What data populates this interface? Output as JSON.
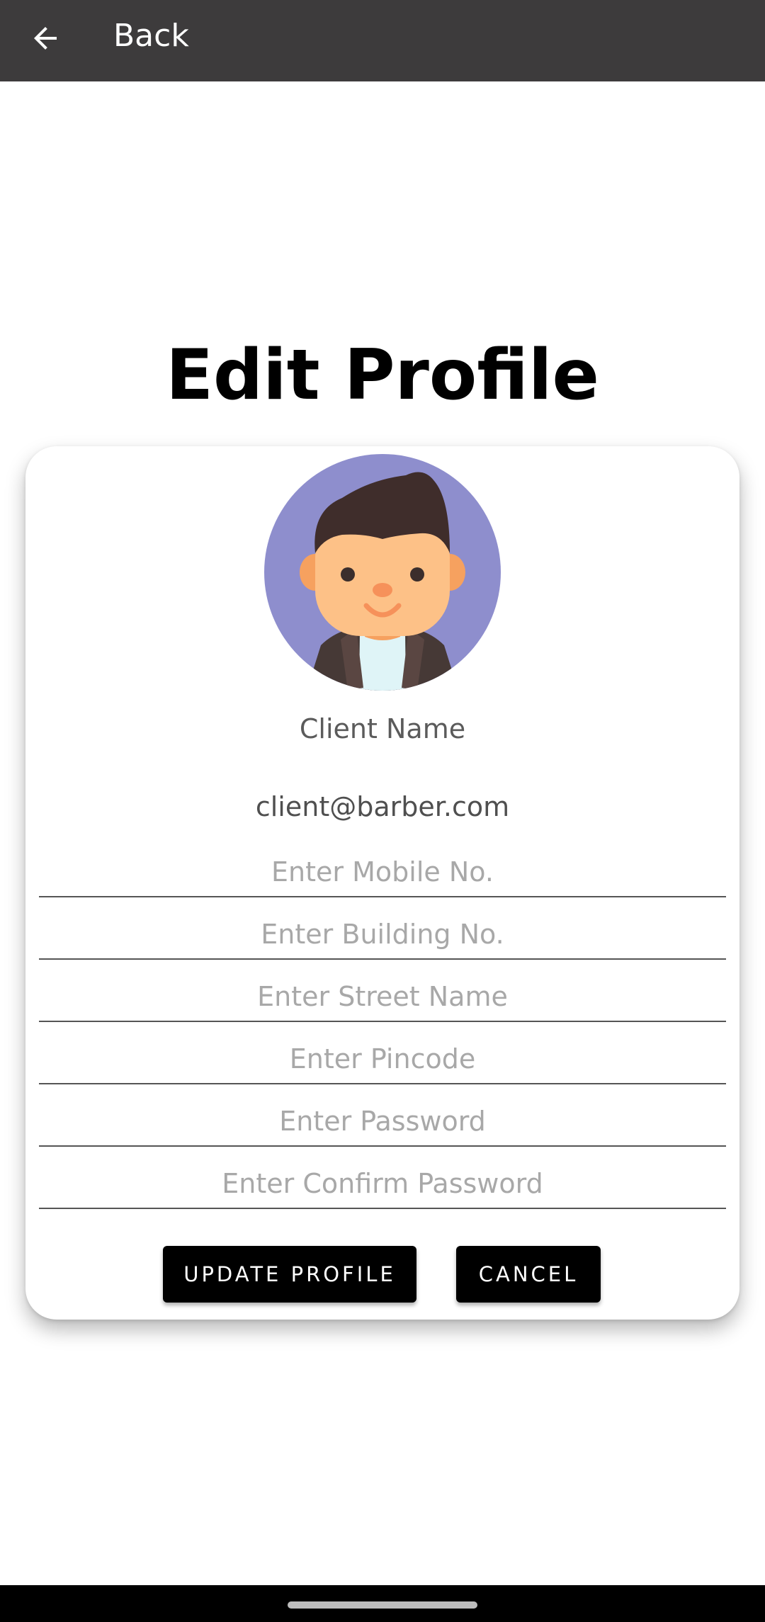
{
  "app_bar": {
    "back_label": "Back",
    "background": "#3d3b3c"
  },
  "page": {
    "title": "Edit Profile"
  },
  "profile": {
    "avatar": "boy-avatar-icon",
    "name": "Client Name",
    "email": "client@barber.com"
  },
  "form": {
    "fields": [
      {
        "name": "mobile",
        "value": "",
        "placeholder": "Enter Mobile No."
      },
      {
        "name": "building",
        "value": "",
        "placeholder": "Enter Building No."
      },
      {
        "name": "street",
        "value": "",
        "placeholder": "Enter Street Name"
      },
      {
        "name": "pincode",
        "value": "",
        "placeholder": "Enter Pincode"
      },
      {
        "name": "password",
        "value": "",
        "placeholder": "Enter Password"
      },
      {
        "name": "confirm_password",
        "value": "",
        "placeholder": "Enter Confirm Password"
      }
    ],
    "update_label": "UPDATE PROFILE",
    "cancel_label": "CANCEL"
  },
  "colors": {
    "button_bg": "#000000",
    "button_text": "#ffffff",
    "avatar_bg": "#8e8ecd"
  }
}
